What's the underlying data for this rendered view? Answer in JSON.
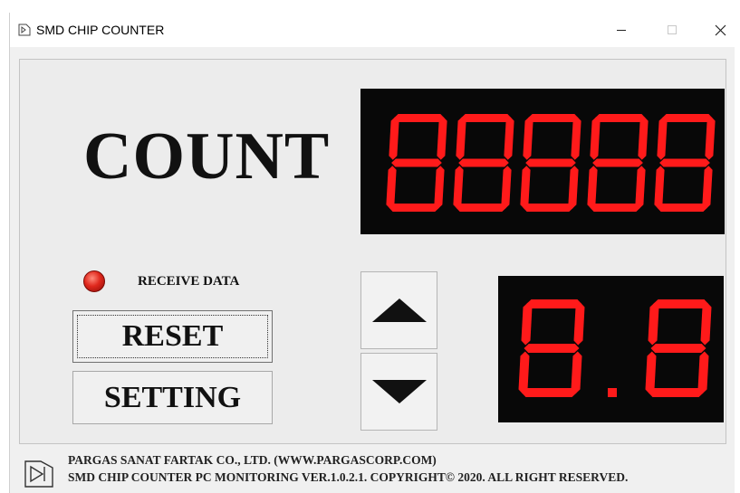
{
  "window": {
    "title": "SMD CHIP COUNTER"
  },
  "main": {
    "count_label": "COUNT",
    "count_display": "88888",
    "setting_display": "8.8",
    "led_label": "RECEIVE DATA",
    "led_color": "#e0281d",
    "segment_color": "#ff1a1a",
    "buttons": {
      "reset": "RESET",
      "setting": "SETTING"
    },
    "icons": {
      "up": "arrow-up-icon",
      "down": "arrow-down-icon"
    }
  },
  "footer": {
    "line1": "PARGAS SANAT FARTAK CO., LTD. (WWW.PARGASCORP.COM)",
    "line2": "SMD CHIP COUNTER PC MONITORING VER.1.0.2.1. COPYRIGHT© 2020. ALL RIGHT RESERVED."
  }
}
